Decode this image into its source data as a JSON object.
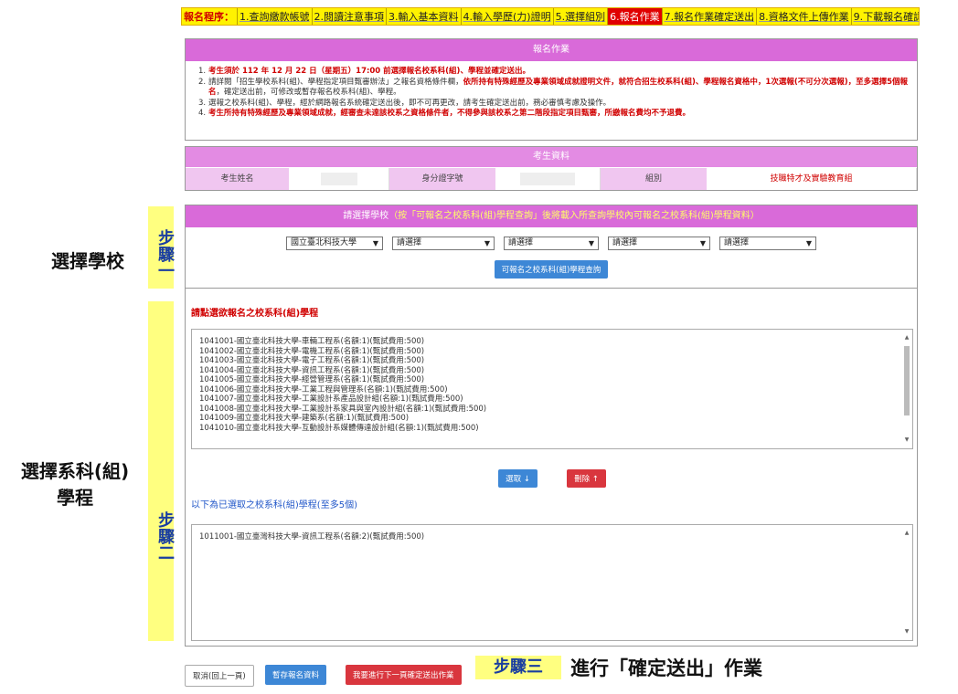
{
  "process": {
    "label": "報名程序：",
    "steps": [
      "1.查詢繳款帳號",
      "2.閱讀注意事項",
      "3.輸入基本資料",
      "4.輸入學歷(力)證明",
      "5.選擇組別",
      "6.報名作業",
      "7.報名作業確定送出",
      "8.資格文件上傳作業",
      "9.下載報名確認單"
    ]
  },
  "notice": {
    "title": "報名作業",
    "lines": [
      {
        "num": "1.",
        "a": "考生須於 112 年 12 月 22 日（星期五）17:00 前選擇報名校系科(組)、學程並確定送出。"
      },
      {
        "num": "2.",
        "a": "請詳閱「招生學校系科(組)、學程指定項目甄審辦法」之報名資格條件欄，",
        "b": "依所持有特殊經歷及專業領域成就證明文件，就符合招生校系科(組)、學程報名資格中，1次選報(不可分次選報)，至多選擇5個報名",
        "c": "，確定送出前，可修改或暫存報名校系科(組)、學程。"
      },
      {
        "num": "3.",
        "a": "選報之校系科(組)、學程，經於網路報名系統確定送出後，即不可再更改，請考生確定送出前，務必審慎考慮及操作。"
      },
      {
        "num": "4.",
        "a": "考生所持有特殊經歷及專業領域成就，經審查未達該校系之資格條件者，不得參與該校系之第二階段指定項目甄審，所繳報名費均不予退費。"
      }
    ]
  },
  "student": {
    "title": "考生資料",
    "name_label": "考生姓名",
    "id_label": "身分證字號",
    "group_label": "組別",
    "group_value": "技職特才及實驗教育組"
  },
  "step1": {
    "title_a": "請選擇學校",
    "title_b": "（按「可報名之校系科(組)學程查詢」後將載入所查詢學校內可報名之校系科(組)學程資料）",
    "school_select": "國立臺北科技大學",
    "select_placeholder": "請選擇",
    "query_button": "可報名之校系科(組)學程查詢"
  },
  "step2": {
    "list_title": "請點選欲報名之校系科(組)學程",
    "programs": [
      "1041001-國立臺北科技大學-車輛工程系(名額:1)(甄試費用:500)",
      "1041002-國立臺北科技大學-電機工程系(名額:1)(甄試費用:500)",
      "1041003-國立臺北科技大學-電子工程系(名額:1)(甄試費用:500)",
      "1041004-國立臺北科技大學-資訊工程系(名額:1)(甄試費用:500)",
      "1041005-國立臺北科技大學-經營管理系(名額:1)(甄試費用:500)",
      "1041006-國立臺北科技大學-工業工程與管理系(名額:1)(甄試費用:500)",
      "1041007-國立臺北科技大學-工業設計系產品設計組(名額:1)(甄試費用:500)",
      "1041008-國立臺北科技大學-工業設計系家具與室內設計組(名額:1)(甄試費用:500)",
      "1041009-國立臺北科技大學-建築系(名額:1)(甄試費用:500)",
      "1041010-國立臺北科技大學-互動設計系媒體傳達設計組(名額:1)(甄試費用:500)"
    ],
    "pick_button": "選取 ↓",
    "remove_button": "刪除 ↑",
    "selected_title": "以下為已選取之校系科(組)學程(至多5個)",
    "selected": [
      "1011001-國立臺灣科技大學-資訊工程系(名額:2)(甄試費用:500)"
    ]
  },
  "footer": {
    "back_button": "取消(回上一頁)",
    "save_button": "暫存報名資料",
    "next_button": "我要進行下一頁確定送出作業",
    "step3_tag": "步驟三",
    "step3_text": "進行「確定送出」作業"
  },
  "annotations": {
    "left1": "選擇學校",
    "left2a": "選擇系科(組)",
    "left2b": "學程",
    "step1_tag": "步驟一",
    "step2_tag": "步驟二"
  }
}
